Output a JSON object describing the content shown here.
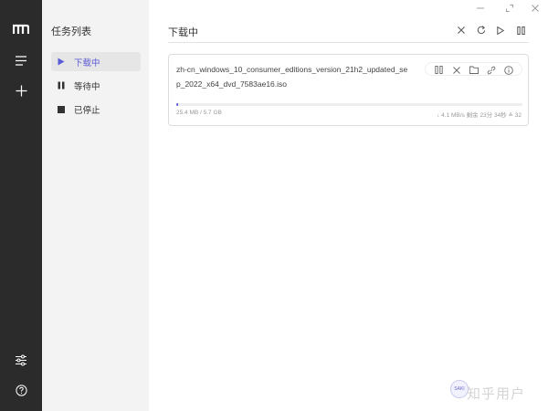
{
  "sidebar": {
    "title": "任务列表",
    "items": [
      {
        "label": "下载中",
        "icon": "play-icon",
        "active": true
      },
      {
        "label": "等待中",
        "icon": "pause-icon",
        "active": false
      },
      {
        "label": "已停止",
        "icon": "stop-icon",
        "active": false
      }
    ]
  },
  "rail": {
    "icons": [
      "app-logo-icon",
      "menu-icon",
      "add-icon",
      "settings-icon",
      "help-icon"
    ]
  },
  "window": {
    "controls": [
      "minimize-icon",
      "maximize-icon",
      "close-icon"
    ]
  },
  "page": {
    "title": "下载中",
    "toolbar": [
      "delete-all-icon",
      "refresh-icon",
      "resume-all-icon",
      "pause-all-icon"
    ]
  },
  "task": {
    "name": "zh-cn_windows_10_consumer_editions_version_21h2_updated_sep_2022_x64_dvd_7583ae16.iso",
    "progress_fraction": 0.004,
    "size_text": "25.4 MB / 5.7 GB",
    "speed_text": "↓ 4.1 MB/s  剩余 23分 34秒  ≗ 32",
    "actions": [
      "pause-icon",
      "delete-icon",
      "folder-icon",
      "link-icon",
      "info-icon"
    ]
  },
  "watermark": {
    "text": "知乎用户",
    "badge": "SAKI"
  },
  "colors": {
    "accent": "#5b5bd6",
    "rail": "#2b2b2b",
    "sidebar": "#f3f3f3"
  }
}
